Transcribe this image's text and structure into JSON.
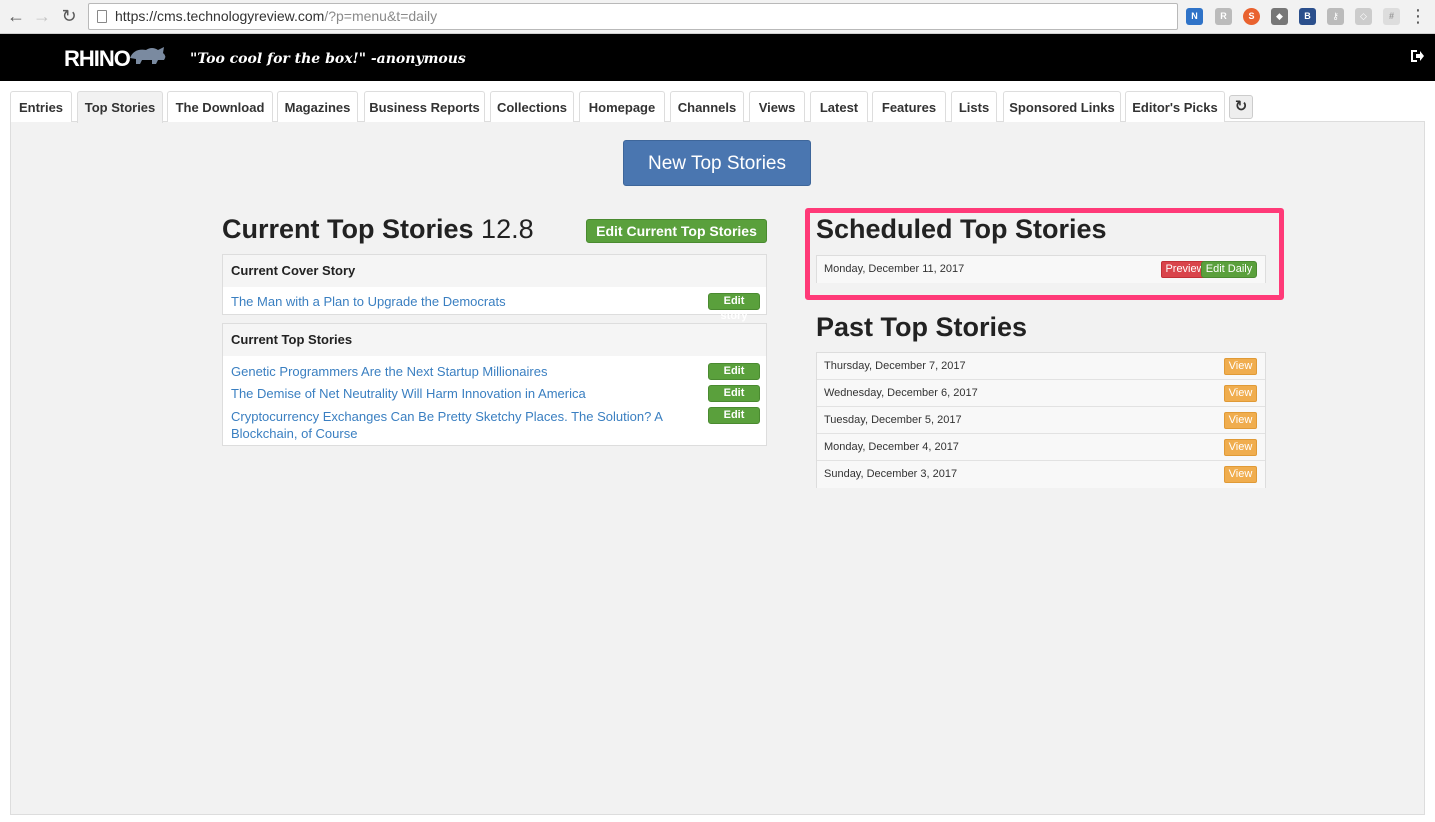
{
  "browser": {
    "url_host": "https://cms.technologyreview.com",
    "url_path": "/?p=menu&t=daily"
  },
  "app": {
    "logo": "RHINO",
    "tagline": "\"Too cool for the box!\" -anonymous"
  },
  "tabs": [
    {
      "label": "Entries"
    },
    {
      "label": "Top Stories"
    },
    {
      "label": "The Download"
    },
    {
      "label": "Magazines"
    },
    {
      "label": "Business Reports"
    },
    {
      "label": "Collections"
    },
    {
      "label": "Homepage"
    },
    {
      "label": "Channels"
    },
    {
      "label": "Views"
    },
    {
      "label": "Latest"
    },
    {
      "label": "Features"
    },
    {
      "label": "Lists"
    },
    {
      "label": "Sponsored Links"
    },
    {
      "label": "Editor's Picks"
    }
  ],
  "active_tab": "Top Stories",
  "new_button": "New Top Stories",
  "current": {
    "title": "Current Top Stories",
    "version": "12.8",
    "edit_button": "Edit Current Top Stories",
    "cover_heading": "Current Cover Story",
    "cover_story": "The Man with a Plan to Upgrade the Democrats",
    "stories_heading": "Current Top Stories",
    "stories": [
      "Genetic Programmers Are the Next Startup Millionaires",
      "The Demise of Net Neutrality Will Harm Innovation in America",
      "Cryptocurrency Exchanges Can Be Pretty Sketchy Places. The Solution? A Blockchain, of Course"
    ],
    "edit_story_label": "Edit story"
  },
  "scheduled": {
    "title": "Scheduled Top Stories",
    "date": "Monday, December 11, 2017",
    "preview_label": "Preview",
    "edit_daily_label": "Edit Daily"
  },
  "past": {
    "title": "Past Top Stories",
    "view_label": "View",
    "dates": [
      "Thursday, December 7, 2017",
      "Wednesday, December 6, 2017",
      "Tuesday, December 5, 2017",
      "Monday, December 4, 2017",
      "Sunday, December 3, 2017"
    ]
  },
  "colors": {
    "primary": "#4a76b0",
    "success": "#5aa03c",
    "danger": "#d9444b",
    "warning": "#f0ad4e",
    "highlight": "#ff3a78",
    "link": "#3a7fc1"
  }
}
